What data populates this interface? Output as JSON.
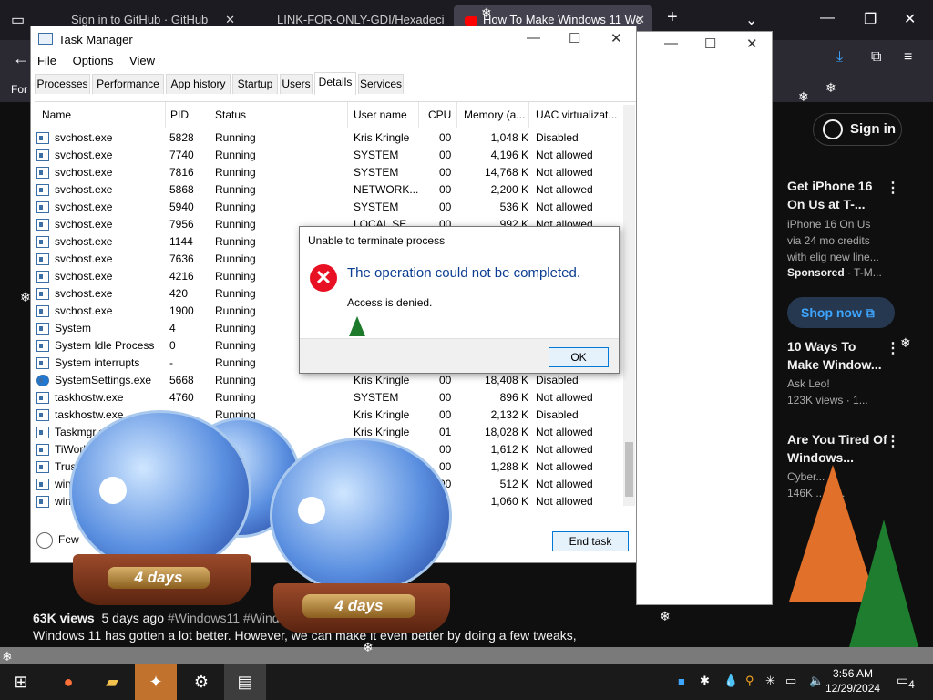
{
  "browser": {
    "tabs": [
      {
        "label": "Sign in to GitHub · GitHub"
      },
      {
        "label": "LINK-FOR-ONLY-GDI/Hexadeci"
      },
      {
        "label": "How To Make Windows 11 Wo"
      }
    ],
    "new_tab": "+",
    "nav_text": "For"
  },
  "youtube": {
    "signin": "Sign in",
    "ad": {
      "title": "Get iPhone 16 On Us at T-...",
      "desc": "iPhone 16 On Us via 24 mo credits with elig new line...",
      "sponsored": "Sponsored",
      "sponsor_name": "· T-M...",
      "shop": "Shop now"
    },
    "recs": [
      {
        "title": "10 Ways To Make Window...",
        "channel": "Ask Leo!",
        "meta": "123K views · 1..."
      },
      {
        "title": "Are You Tired Of Windows...",
        "channel": "Cyber...",
        "meta": "146K ... D..."
      }
    ],
    "views": "63K views",
    "age": "5 days ago",
    "tags": "#Windows11 #Windo",
    "description": "Windows 11 has gotten a lot better. However, we can make it even better by doing a few tweaks,"
  },
  "taskmanager": {
    "title": "Task Manager",
    "menu": [
      "File",
      "Options",
      "View"
    ],
    "tabs": [
      "Processes",
      "Performance",
      "App history",
      "Startup",
      "Users",
      "Details",
      "Services"
    ],
    "columns": [
      "Name",
      "PID",
      "Status",
      "User name",
      "CPU",
      "Memory (a...",
      "UAC virtualizat..."
    ],
    "rows": [
      {
        "name": "svchost.exe",
        "pid": "5828",
        "status": "Running",
        "user": "Kris Kringle",
        "cpu": "00",
        "mem": "1,048 K",
        "uac": "Disabled"
      },
      {
        "name": "svchost.exe",
        "pid": "7740",
        "status": "Running",
        "user": "SYSTEM",
        "cpu": "00",
        "mem": "4,196 K",
        "uac": "Not allowed"
      },
      {
        "name": "svchost.exe",
        "pid": "7816",
        "status": "Running",
        "user": "SYSTEM",
        "cpu": "00",
        "mem": "14,768 K",
        "uac": "Not allowed"
      },
      {
        "name": "svchost.exe",
        "pid": "5868",
        "status": "Running",
        "user": "NETWORK...",
        "cpu": "00",
        "mem": "2,200 K",
        "uac": "Not allowed"
      },
      {
        "name": "svchost.exe",
        "pid": "5940",
        "status": "Running",
        "user": "SYSTEM",
        "cpu": "00",
        "mem": "536 K",
        "uac": "Not allowed"
      },
      {
        "name": "svchost.exe",
        "pid": "7956",
        "status": "Running",
        "user": "LOCAL SE...",
        "cpu": "00",
        "mem": "992 K",
        "uac": "Not allowed"
      },
      {
        "name": "svchost.exe",
        "pid": "1144",
        "status": "Running",
        "user": "",
        "cpu": "",
        "mem": "",
        "uac": ""
      },
      {
        "name": "svchost.exe",
        "pid": "7636",
        "status": "Running",
        "user": "",
        "cpu": "",
        "mem": "",
        "uac": ""
      },
      {
        "name": "svchost.exe",
        "pid": "4216",
        "status": "Running",
        "user": "",
        "cpu": "",
        "mem": "",
        "uac": ""
      },
      {
        "name": "svchost.exe",
        "pid": "420",
        "status": "Running",
        "user": "",
        "cpu": "",
        "mem": "",
        "uac": ""
      },
      {
        "name": "svchost.exe",
        "pid": "1900",
        "status": "Running",
        "user": "",
        "cpu": "",
        "mem": "",
        "uac": ""
      },
      {
        "name": "System",
        "pid": "4",
        "status": "Running",
        "user": "",
        "cpu": "",
        "mem": "",
        "uac": ""
      },
      {
        "name": "System Idle Process",
        "pid": "0",
        "status": "Running",
        "user": "",
        "cpu": "",
        "mem": "",
        "uac": ""
      },
      {
        "name": "System interrupts",
        "pid": "-",
        "status": "Running",
        "user": "",
        "cpu": "",
        "mem": "",
        "uac": ""
      },
      {
        "name": "SystemSettings.exe",
        "pid": "5668",
        "status": "Running",
        "user": "Kris Kringle",
        "cpu": "00",
        "mem": "18,408 K",
        "uac": "Disabled"
      },
      {
        "name": "taskhostw.exe",
        "pid": "4760",
        "status": "Running",
        "user": "SYSTEM",
        "cpu": "00",
        "mem": "896 K",
        "uac": "Not allowed"
      },
      {
        "name": "taskhostw.exe",
        "pid": "",
        "status": "Running",
        "user": "Kris Kringle",
        "cpu": "00",
        "mem": "2,132 K",
        "uac": "Disabled"
      },
      {
        "name": "Taskmgr.ex",
        "pid": "",
        "status": "",
        "user": "Kris Kringle",
        "cpu": "01",
        "mem": "18,028 K",
        "uac": "Not allowed"
      },
      {
        "name": "TiWork",
        "pid": "",
        "status": "",
        "user": "",
        "cpu": "00",
        "mem": "1,612 K",
        "uac": "Not allowed"
      },
      {
        "name": "Trust",
        "pid": "",
        "status": "",
        "user": "",
        "cpu": "00",
        "mem": "1,288 K",
        "uac": "Not allowed"
      },
      {
        "name": "wini",
        "pid": "",
        "status": "",
        "user": "",
        "cpu": "00",
        "mem": "512 K",
        "uac": "Not allowed"
      },
      {
        "name": "wini",
        "pid": "",
        "status": "",
        "user": "",
        "cpu": "",
        "mem": "1,060 K",
        "uac": "Not allowed"
      }
    ],
    "fewer": "Few",
    "end_task": "End task"
  },
  "dialog": {
    "title": "Unable to terminate process",
    "main": "The operation could not be completed.",
    "sub": "Access is denied.",
    "ok": "OK"
  },
  "globes": [
    {
      "label": "4 days"
    },
    {
      "label": "4 days"
    }
  ],
  "taskbar": {
    "time": "3:56 AM",
    "date": "12/29/2024",
    "notif": "4"
  }
}
